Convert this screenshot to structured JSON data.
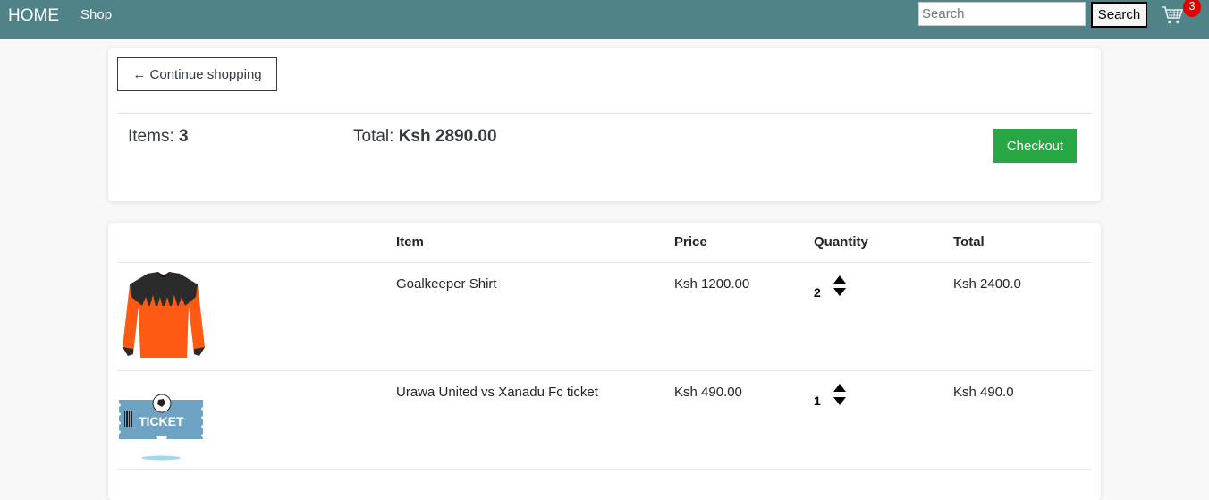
{
  "navbar": {
    "brand": "HOME",
    "shop_link": "Shop",
    "search_placeholder": "Search",
    "search_button": "Search",
    "cart_count": "3"
  },
  "summary": {
    "continue_label": "← Continue shopping",
    "items_label": "Items:",
    "items_count": "3",
    "total_label": "Total:",
    "total_amount": "Ksh 2890.00",
    "checkout_label": "Checkout"
  },
  "table": {
    "headers": {
      "item": "Item",
      "price": "Price",
      "quantity": "Quantity",
      "total": "Total"
    },
    "rows": [
      {
        "image": "goalkeeper-shirt-image",
        "name": "Goalkeeper Shirt",
        "price": "Ksh 1200.00",
        "quantity": "2",
        "total": "Ksh 2400.0"
      },
      {
        "image": "ticket-image",
        "name": "Urawa United vs Xanadu Fc ticket",
        "price": "Ksh 490.00",
        "quantity": "1",
        "total": "Ksh 490.0"
      }
    ]
  },
  "colors": {
    "navbar_bg": "#4f8388",
    "checkout_green": "#28a745",
    "badge_red": "#e00000",
    "shirt_orange": "#ff5a14",
    "ticket_blue": "#6fa3c4"
  }
}
